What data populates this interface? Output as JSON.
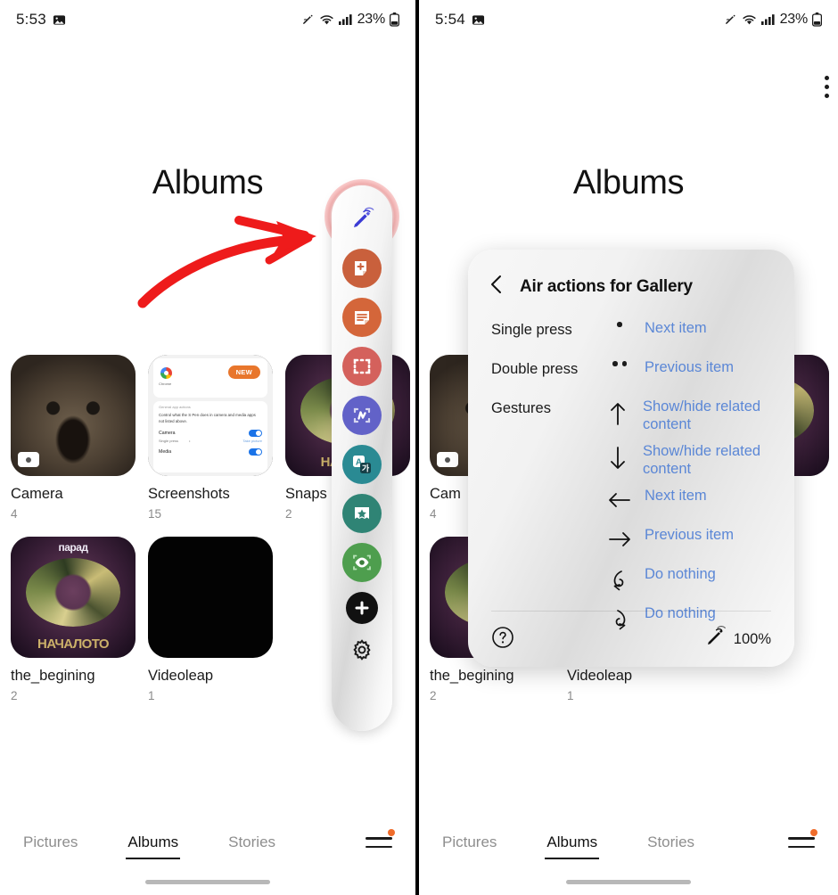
{
  "left": {
    "status": {
      "time": "5:53",
      "battery": "23%",
      "icons": [
        "gallery-icon",
        "spen-icon",
        "wifi-icon",
        "signal-icon",
        "battery-icon"
      ]
    },
    "title": "Albums",
    "albums": [
      {
        "name": "Camera",
        "count": "4",
        "thumb": "dog-photo",
        "badge": "camera-badge"
      },
      {
        "name": "Screenshots",
        "count": "15",
        "thumb": "settings-screenshot"
      },
      {
        "name": "Snaps",
        "count": "2",
        "thumb": "dragon-poster"
      },
      {
        "name": "the_begining",
        "count": "2",
        "thumb": "dragon-poster"
      },
      {
        "name": "Videoleap",
        "count": "1",
        "thumb": "black"
      }
    ],
    "air_command": {
      "items": [
        {
          "name": "air-actions-pen-icon",
          "color": "#ffffff",
          "highlighted": true
        },
        {
          "name": "create-note-icon",
          "color": "#c9603c"
        },
        {
          "name": "view-notes-icon",
          "color": "#d4663a"
        },
        {
          "name": "smart-select-icon",
          "color": "#d4615c"
        },
        {
          "name": "screen-write-icon",
          "color": "#6262c8"
        },
        {
          "name": "translate-icon",
          "color": "#2a8a93"
        },
        {
          "name": "ar-doodle-icon",
          "color": "#2f8475"
        },
        {
          "name": "bixby-vision-icon",
          "color": "#4e9e4e"
        },
        {
          "name": "add-shortcut-icon",
          "color": "#111111"
        },
        {
          "name": "settings-gear-icon",
          "color": "#1b1b1b"
        }
      ]
    },
    "annotation": {
      "type": "red-arrow",
      "color": "#ee1b1b"
    },
    "nav": {
      "items": [
        "Pictures",
        "Albums",
        "Stories"
      ],
      "active": "Albums",
      "menu_badge": true
    }
  },
  "right": {
    "status": {
      "time": "5:54",
      "battery": "23%"
    },
    "title": "Albums",
    "albums": [
      {
        "name": "Cam",
        "count": "4",
        "thumb": "dog-photo",
        "badge": "camera-badge"
      },
      {
        "name": "the_begining",
        "count": "2",
        "thumb": "dragon-poster"
      },
      {
        "name": "Videoleap",
        "count": "1",
        "thumb": "black"
      }
    ],
    "dialog": {
      "back_icon": "back-chevron-icon",
      "title": "Air actions for Gallery",
      "kebab_icon": "more-options-icon",
      "rows": [
        {
          "label": "Single press",
          "glyph": "one-dot",
          "value": "Next item"
        },
        {
          "label": "Double press",
          "glyph": "two-dots",
          "value": "Previous item"
        },
        {
          "label": "Gestures",
          "glyph": "arrow-up",
          "value": "Show/hide related content"
        },
        {
          "label": "",
          "glyph": "arrow-down",
          "value": "Show/hide related content"
        },
        {
          "label": "",
          "glyph": "arrow-left",
          "value": "Next item"
        },
        {
          "label": "",
          "glyph": "arrow-right",
          "value": "Previous item"
        },
        {
          "label": "",
          "glyph": "swirl-ccw",
          "value": "Do nothing"
        },
        {
          "label": "",
          "glyph": "swirl-cw",
          "value": "Do nothing"
        }
      ],
      "help_icon": "help-circle-icon",
      "pen_icon": "spen-battery-icon",
      "battery_pct": "100%"
    },
    "nav": {
      "items": [
        "Pictures",
        "Albums",
        "Stories"
      ],
      "active": "Albums",
      "menu_badge": true
    }
  }
}
